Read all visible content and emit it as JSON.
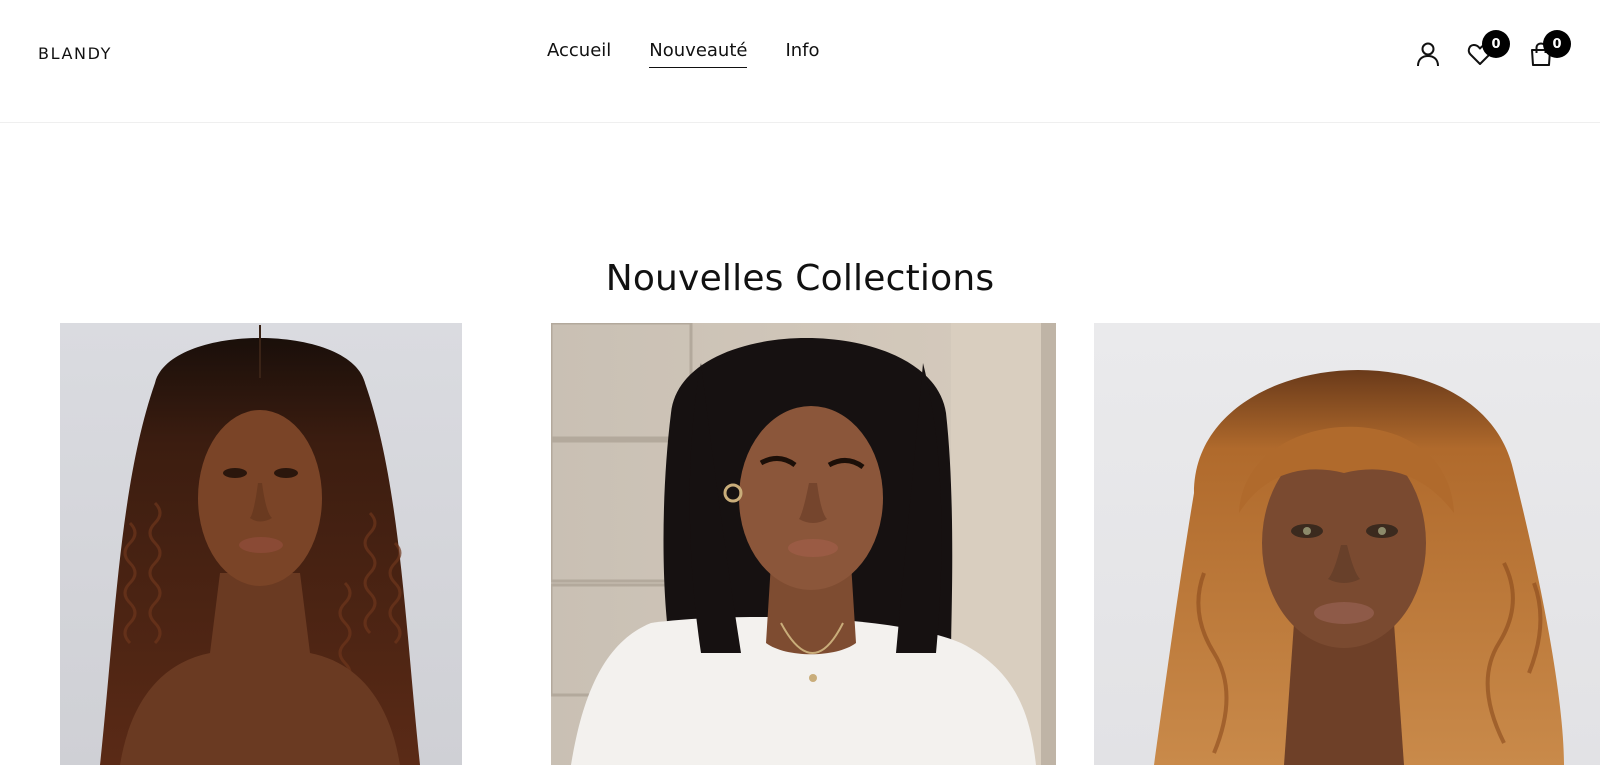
{
  "header": {
    "logo": "BLANDY",
    "nav": [
      {
        "label": "Accueil",
        "active": false
      },
      {
        "label": "Nouveauté",
        "active": true
      },
      {
        "label": "Info",
        "active": false
      }
    ],
    "icons": {
      "account": "user-icon",
      "wishlist": "heart-icon",
      "cart": "bag-icon"
    },
    "wishlist_count": "0",
    "cart_count": "0"
  },
  "main": {
    "section_title": "Nouvelles Collections",
    "products": [
      {
        "image": "long curly brown wig on model",
        "hair_color": "#4a2414"
      },
      {
        "image": "black bob wig on model",
        "hair_color": "#141010"
      },
      {
        "image": "ginger wig with bangs on model",
        "hair_color": "#b06a2c"
      }
    ]
  },
  "colors": {
    "accent": "#000000",
    "background": "#ffffff",
    "text": "#111111"
  }
}
